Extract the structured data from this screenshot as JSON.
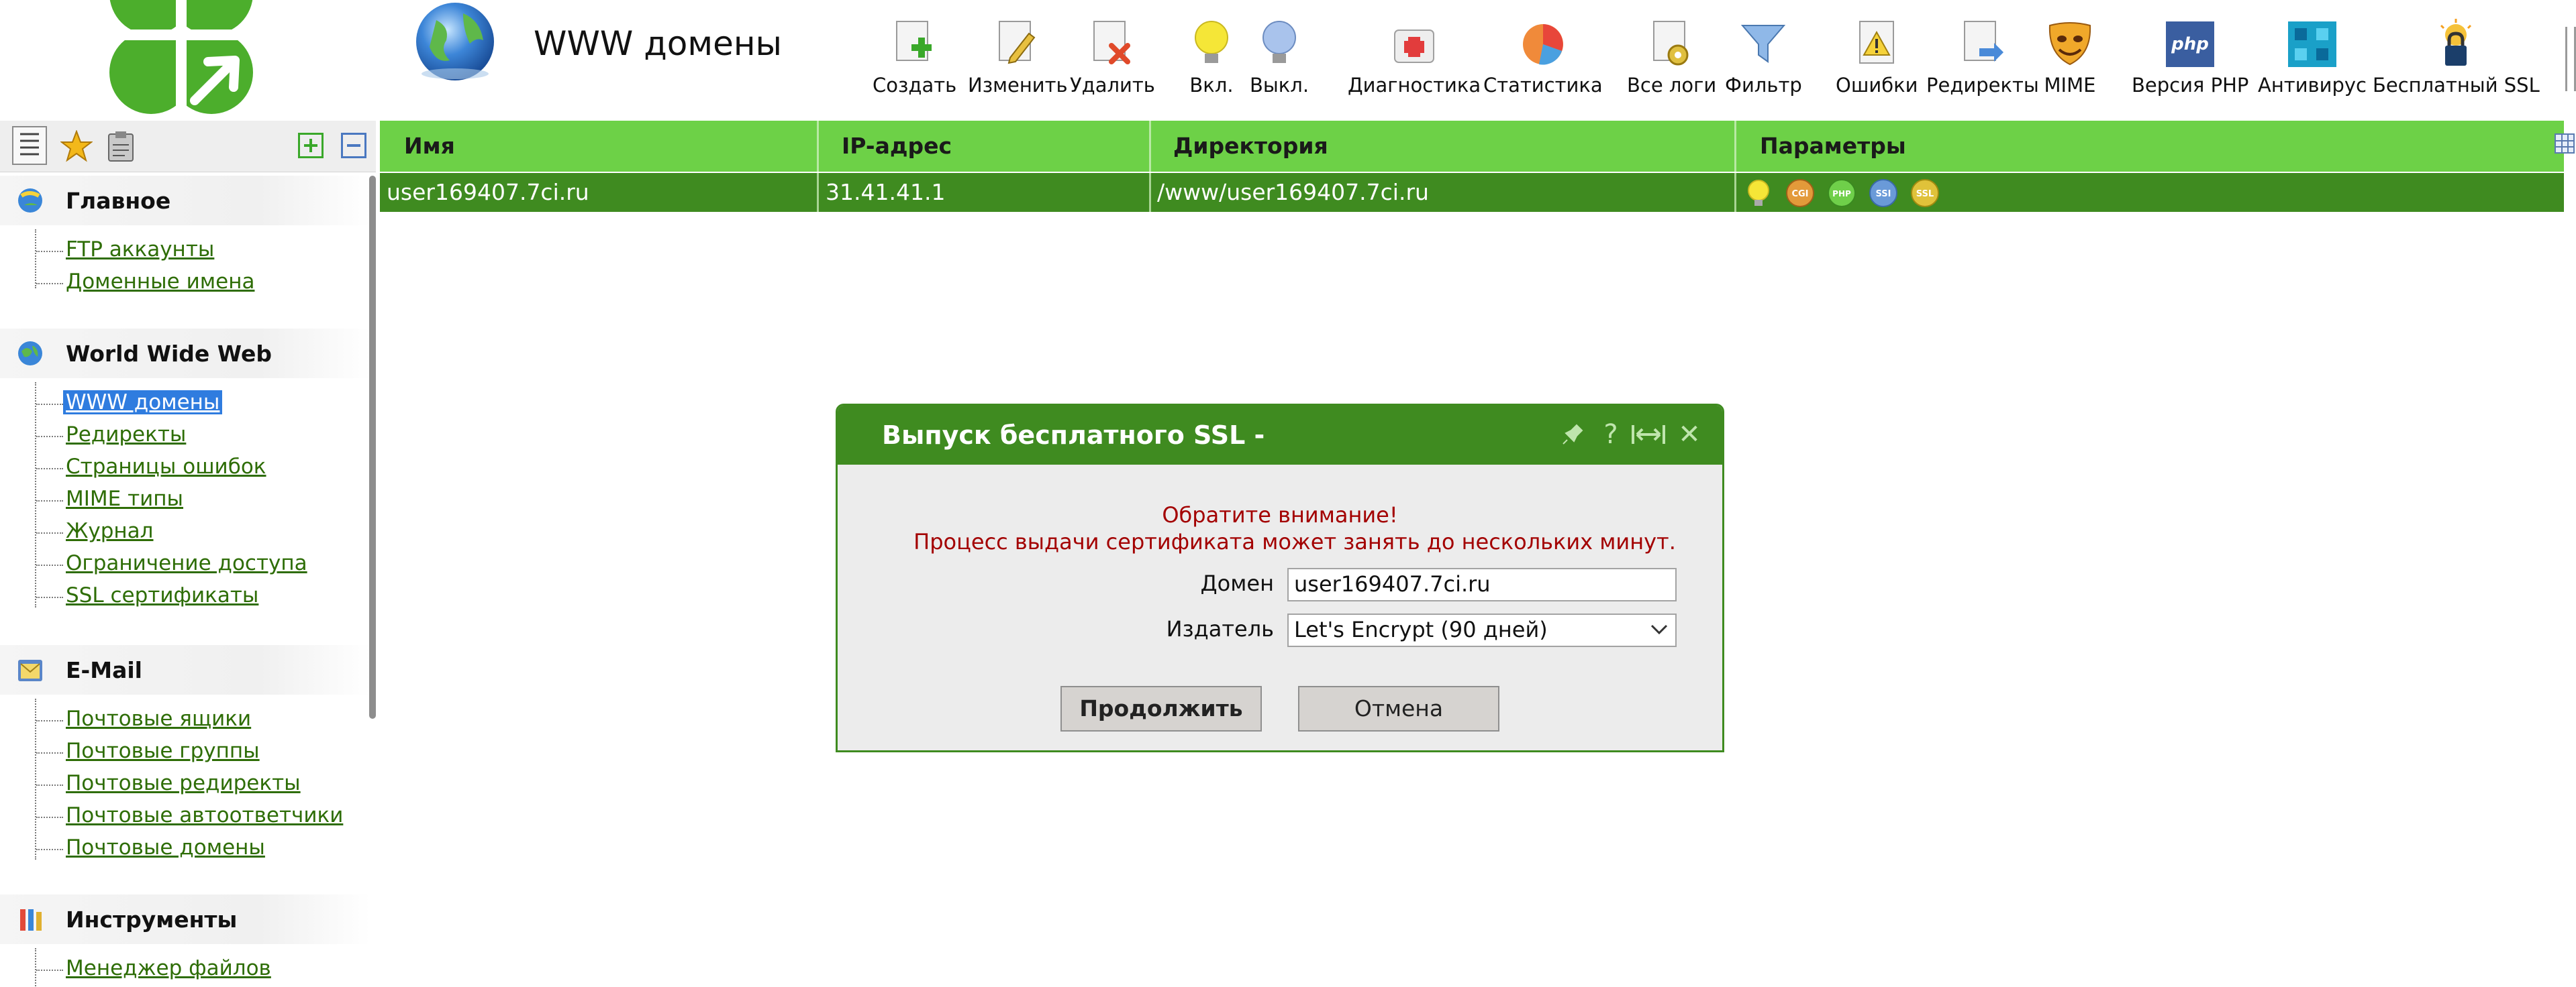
{
  "header": {
    "title": "WWW домены"
  },
  "toolbar": [
    {
      "id": "create",
      "label": "Создать",
      "icon": "create-icon"
    },
    {
      "id": "edit",
      "label": "Изменить",
      "icon": "edit-icon"
    },
    {
      "id": "delete",
      "label": "Удалить",
      "icon": "delete-icon"
    },
    {
      "id": "on",
      "label": "Вкл.",
      "icon": "bulb-on-icon"
    },
    {
      "id": "off",
      "label": "Выкл.",
      "icon": "bulb-off-icon"
    },
    {
      "id": "diag",
      "label": "Диагностика",
      "icon": "first-aid-icon"
    },
    {
      "id": "stats",
      "label": "Статистика",
      "icon": "pie-chart-icon"
    },
    {
      "id": "logs",
      "label": "Все логи",
      "icon": "logs-gear-icon"
    },
    {
      "id": "filter",
      "label": "Фильтр",
      "icon": "funnel-icon"
    },
    {
      "id": "errors",
      "label": "Ошибки",
      "icon": "warning-doc-icon"
    },
    {
      "id": "redirects",
      "label": "Редиректы",
      "icon": "redirect-doc-icon"
    },
    {
      "id": "mime",
      "label": "MIME",
      "icon": "masks-icon"
    },
    {
      "id": "php",
      "label": "Версия PHP",
      "icon": "php-icon"
    },
    {
      "id": "av",
      "label": "Антивирус",
      "icon": "antivirus-icon"
    },
    {
      "id": "ssl",
      "label": "Бесплатный SSL",
      "icon": "ssl-lock-icon"
    }
  ],
  "sidebar": {
    "sections": [
      {
        "title": "Главное",
        "icon": "main-globe-icon",
        "items": [
          {
            "label": "FTP аккаунты"
          },
          {
            "label": "Доменные имена"
          }
        ]
      },
      {
        "title": "World Wide Web",
        "icon": "web-globe-icon",
        "items": [
          {
            "label": "WWW домены",
            "selected": true
          },
          {
            "label": "Редиректы"
          },
          {
            "label": "Страницы ошибок"
          },
          {
            "label": "MIME типы"
          },
          {
            "label": "Журнал"
          },
          {
            "label": "Ограничение доступа"
          },
          {
            "label": "SSL сертификаты"
          }
        ]
      },
      {
        "title": "E-Mail",
        "icon": "mail-icon",
        "items": [
          {
            "label": "Почтовые ящики"
          },
          {
            "label": "Почтовые группы"
          },
          {
            "label": "Почтовые редиректы"
          },
          {
            "label": "Почтовые автоответчики"
          },
          {
            "label": "Почтовые домены"
          }
        ]
      },
      {
        "title": "Инструменты",
        "icon": "tools-icon",
        "items": [
          {
            "label": "Менеджер файлов"
          }
        ]
      }
    ]
  },
  "table": {
    "columns": [
      "Имя",
      "IP-адрес",
      "Директория",
      "Параметры"
    ],
    "rows": [
      {
        "name": "user169407.7ci.ru",
        "ip": "31.41.41.1",
        "dir": "/www/user169407.7ci.ru",
        "params": [
          {
            "icon": "bulb-on-icon",
            "text": "",
            "color": "#f2e44a"
          },
          {
            "icon": "cgi-badge-icon",
            "text": "CGI",
            "color": "#e39a3a"
          },
          {
            "icon": "php-badge-icon",
            "text": "PHP",
            "color": "#6fcf4a"
          },
          {
            "icon": "ssi-badge-icon",
            "text": "SSI",
            "color": "#6a9ad8"
          },
          {
            "icon": "ssl-badge-icon",
            "text": "SSL",
            "color": "#e0c23a"
          }
        ]
      }
    ]
  },
  "dialog": {
    "title": "Выпуск бесплатного SSL -",
    "warning_line1": "Обратите внимание!",
    "warning_line2": "Процесс выдачи сертификата может занять до нескольких минут.",
    "domain_label": "Домен",
    "domain_value": "user169407.7ci.ru",
    "issuer_label": "Издатель",
    "issuer_value": "Let's Encrypt (90 дней)",
    "ok_label": "Продолжить",
    "cancel_label": "Отмена",
    "help_glyph": "?",
    "close_glyph": "✕"
  }
}
